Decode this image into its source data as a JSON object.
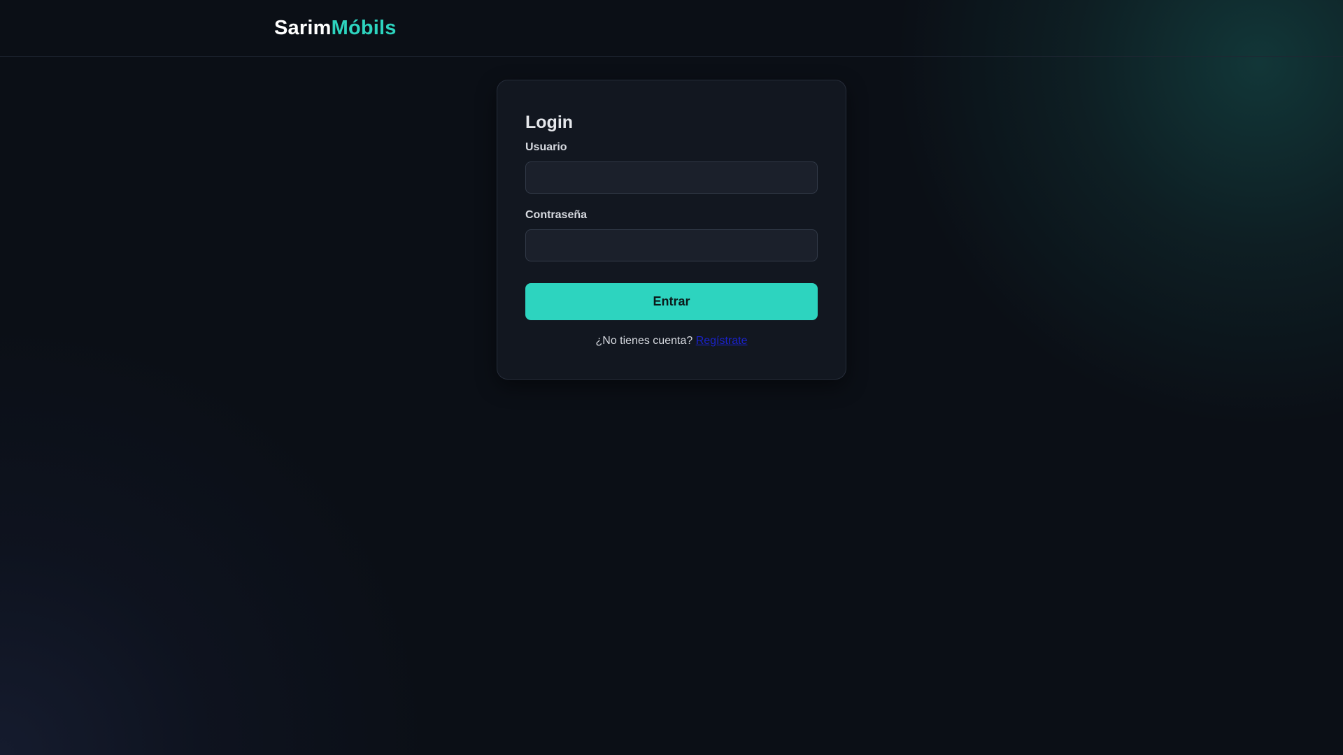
{
  "header": {
    "brand_primary": "Sarim",
    "brand_accent": "Móbils"
  },
  "login": {
    "title": "Login",
    "username_label": "Usuario",
    "username_value": "",
    "password_label": "Contraseña",
    "password_value": "",
    "submit_label": "Entrar",
    "register_prompt": "¿No tienes cuenta?",
    "register_link": "Regístrate"
  },
  "colors": {
    "background": "#0b0f16",
    "card": "#131821",
    "accent": "#2dd4bf",
    "link": "#1a22c9"
  }
}
